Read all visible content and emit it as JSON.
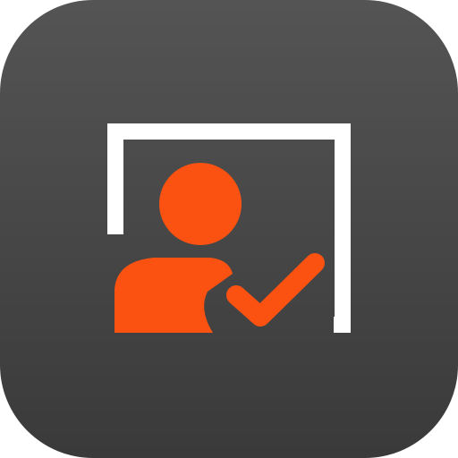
{
  "app_icon": {
    "icon_name": "user-check-frame-icon",
    "colors": {
      "background_top": "#545454",
      "background_bottom": "#3a3a3a",
      "frame": "#ffffff",
      "accent": "#fc5211"
    }
  }
}
